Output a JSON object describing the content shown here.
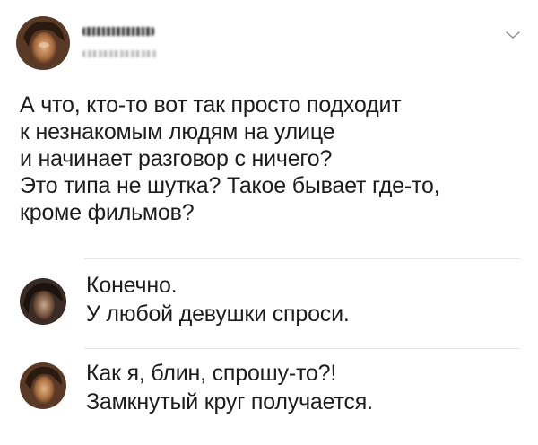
{
  "post": {
    "author_name": "",
    "author_handle": "",
    "text_lines": [
      "А что, кто-то вот так просто подходит",
      "к незнакомым людям на улице",
      "и начинает разговор с ничего?",
      "Это типа не шутка? Такое бывает где-то,",
      "кроме фильмов?"
    ]
  },
  "comments": [
    {
      "text_lines": [
        "Конечно.",
        "У любой девушки спроси."
      ]
    },
    {
      "text_lines": [
        "Как я, блин, спрошу-то?!",
        "Замкнутый круг получается."
      ]
    }
  ],
  "colors": {
    "text": "#1c1c1c",
    "divider": "#e6e6e6",
    "chevron": "#8a8a8a"
  },
  "icons": {
    "menu": "chevron-down-icon"
  }
}
